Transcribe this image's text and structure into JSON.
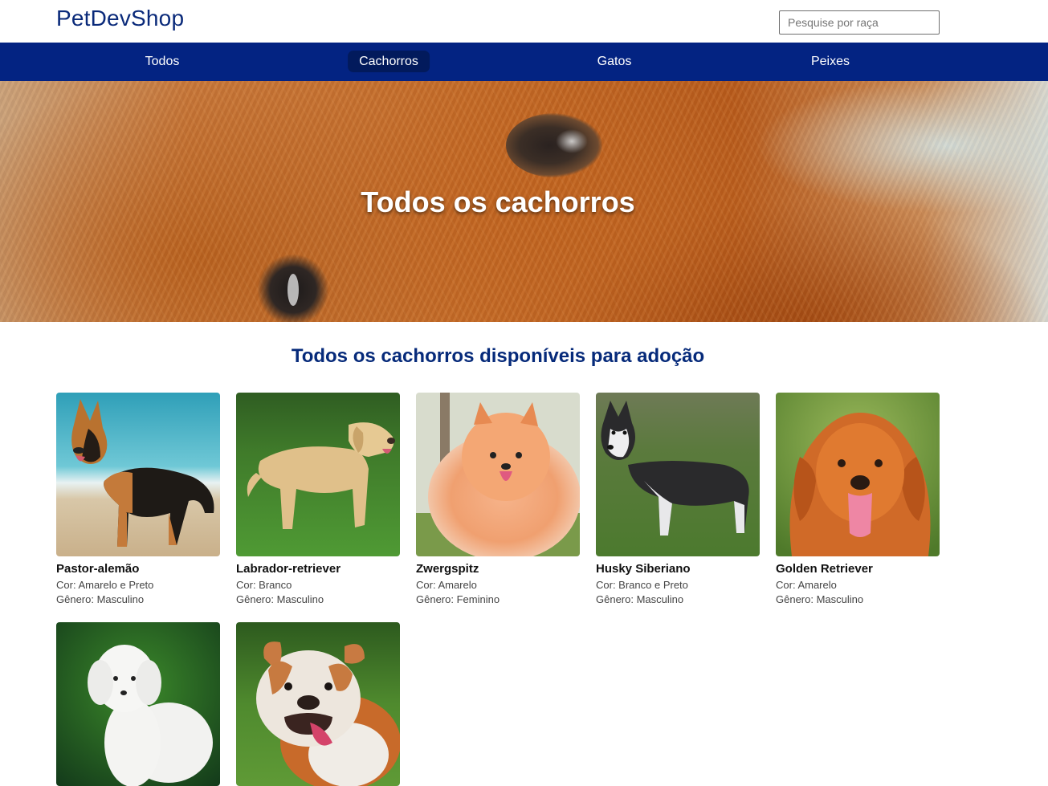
{
  "header": {
    "logo": "PetDevShop",
    "search_placeholder": "Pesquise por raça"
  },
  "nav": {
    "items": [
      {
        "label": "Todos",
        "active": false
      },
      {
        "label": "Cachorros",
        "active": true
      },
      {
        "label": "Gatos",
        "active": false
      },
      {
        "label": "Peixes",
        "active": false
      }
    ]
  },
  "hero": {
    "title": "Todos os cachorros"
  },
  "section": {
    "title": "Todos os cachorros disponíveis para adoção"
  },
  "pets": [
    {
      "name": "Pastor-alemão",
      "color": "Cor: Amarelo e Preto",
      "gender": "Gênero: Masculino",
      "icon": "german-shepherd-photo"
    },
    {
      "name": "Labrador-retriever",
      "color": "Cor: Branco",
      "gender": "Gênero: Masculino",
      "icon": "labrador-photo"
    },
    {
      "name": "Zwergspitz",
      "color": "Cor: Amarelo",
      "gender": "Gênero: Feminino",
      "icon": "pomeranian-photo"
    },
    {
      "name": "Husky Siberiano",
      "color": "Cor: Branco e Preto",
      "gender": "Gênero: Masculino",
      "icon": "husky-photo"
    },
    {
      "name": "Golden Retriever",
      "color": "Cor: Amarelo",
      "gender": "Gênero: Masculino",
      "icon": "golden-retriever-photo"
    },
    {
      "name": "",
      "color": "",
      "gender": "",
      "icon": "poodle-photo"
    },
    {
      "name": "",
      "color": "",
      "gender": "",
      "icon": "bulldog-photo"
    }
  ],
  "colors": {
    "nav_bg": "#032382",
    "nav_active_bg": "#021a5c",
    "brand_blue": "#0a2a7a",
    "section_title": "#062a7a"
  }
}
